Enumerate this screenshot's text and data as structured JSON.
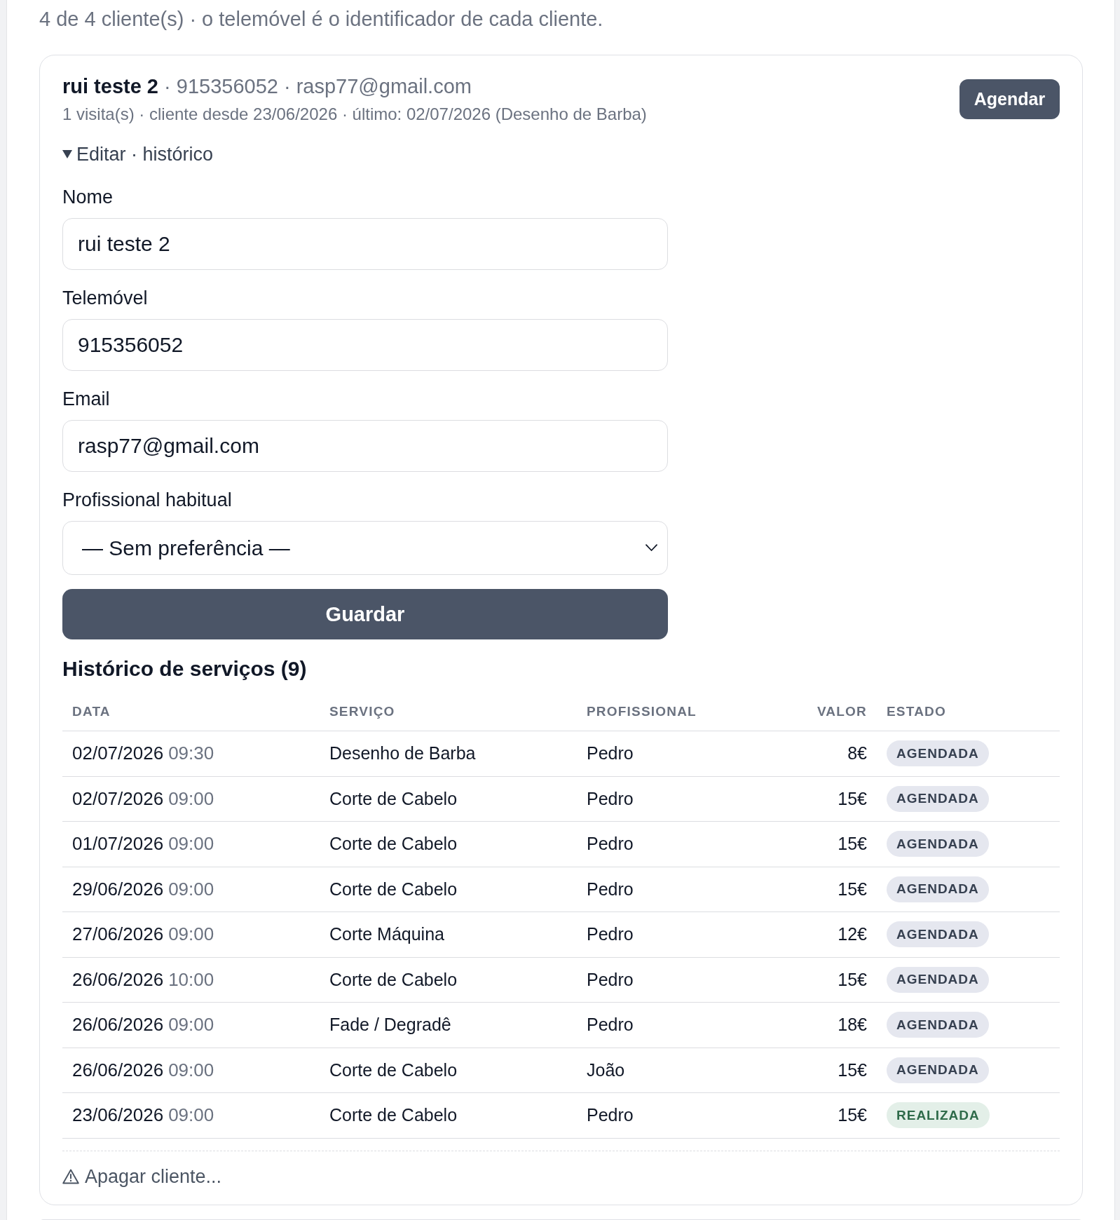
{
  "summary": "4 de 4 cliente(s) · o telemóvel é o identificador de cada cliente.",
  "client": {
    "heading": "**rui teste 2** · 915356052 · rasp77@gmail.com",
    "details": "1 visita(s) · cliente desde 23/06/2026 · último: 02/07/2026 (Desenho de Barba)",
    "action_button": "Agendar",
    "edit_section": {
      "label": "Editar · histórico",
      "expanded": true,
      "fields": [
        {
          "kind": "text",
          "label": "Nome",
          "value": "rui teste 2"
        },
        {
          "kind": "text",
          "label": "Telemóvel",
          "value": "915356052"
        },
        {
          "kind": "text",
          "label": "Email",
          "value": "rasp77@gmail.com"
        },
        {
          "kind": "select",
          "label": "Profissional habitual",
          "value": "— Sem preferência —"
        }
      ],
      "save_button": "Guardar",
      "history": {
        "title": "Histórico de serviços (9)",
        "columns": [
          "DATA",
          "SERVIÇO",
          "PROFISSIONAL",
          "VALOR",
          "ESTADO"
        ],
        "rows": [
          {
            "date": "02/07/2026",
            "time": "09:30",
            "service": "Desenho de Barba",
            "professional": "Pedro",
            "value": "8€",
            "status": {
              "label": "AGENDADA",
              "kind": "scheduled"
            }
          },
          {
            "date": "02/07/2026",
            "time": "09:00",
            "service": "Corte de Cabelo",
            "professional": "Pedro",
            "value": "15€",
            "status": {
              "label": "AGENDADA",
              "kind": "scheduled"
            }
          },
          {
            "date": "01/07/2026",
            "time": "09:00",
            "service": "Corte de Cabelo",
            "professional": "Pedro",
            "value": "15€",
            "status": {
              "label": "AGENDADA",
              "kind": "scheduled"
            }
          },
          {
            "date": "29/06/2026",
            "time": "09:00",
            "service": "Corte de Cabelo",
            "professional": "Pedro",
            "value": "15€",
            "status": {
              "label": "AGENDADA",
              "kind": "scheduled"
            }
          },
          {
            "date": "27/06/2026",
            "time": "09:00",
            "service": "Corte Máquina",
            "professional": "Pedro",
            "value": "12€",
            "status": {
              "label": "AGENDADA",
              "kind": "scheduled"
            }
          },
          {
            "date": "26/06/2026",
            "time": "10:00",
            "service": "Corte de Cabelo",
            "professional": "Pedro",
            "value": "15€",
            "status": {
              "label": "AGENDADA",
              "kind": "scheduled"
            }
          },
          {
            "date": "26/06/2026",
            "time": "09:00",
            "service": "Fade / Degradê",
            "professional": "Pedro",
            "value": "18€",
            "status": {
              "label": "AGENDADA",
              "kind": "scheduled"
            }
          },
          {
            "date": "26/06/2026",
            "time": "09:00",
            "service": "Corte de Cabelo",
            "professional": "João",
            "value": "15€",
            "status": {
              "label": "AGENDADA",
              "kind": "scheduled"
            }
          },
          {
            "date": "23/06/2026",
            "time": "09:00",
            "service": "Corte de Cabelo",
            "professional": "Pedro",
            "value": "15€",
            "status": {
              "label": "REALIZADA",
              "kind": "done"
            }
          }
        ]
      },
      "delete_button": "Apagar cliente..."
    }
  }
}
